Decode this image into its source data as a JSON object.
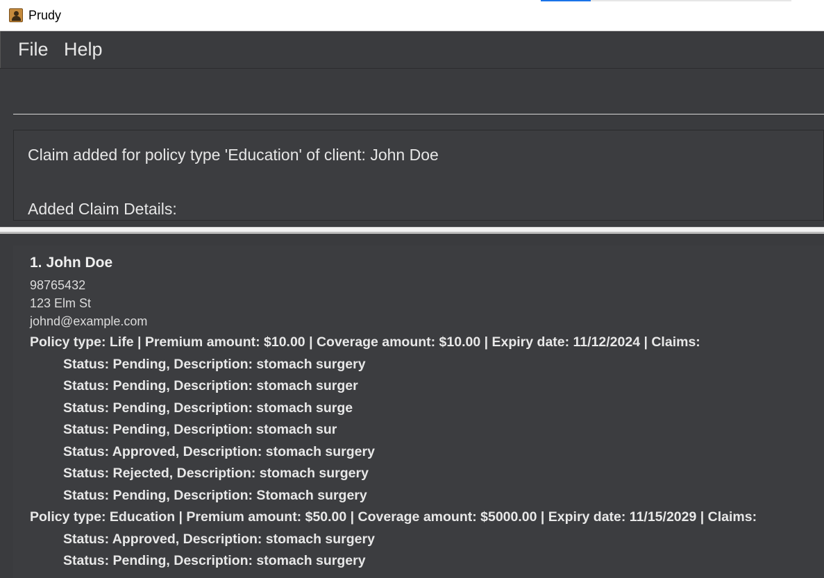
{
  "window": {
    "title": "Prudy"
  },
  "menu": {
    "items": [
      "File",
      "Help"
    ]
  },
  "command_box": {
    "value": "",
    "placeholder": ""
  },
  "result": {
    "lines": [
      "Claim added for policy type 'Education' of client: John Doe",
      "Added Claim Details:"
    ]
  },
  "persons": [
    {
      "index": "1.",
      "name": "John Doe",
      "phone": "98765432",
      "address": "123 Elm St",
      "email": "johnd@example.com",
      "policies": [
        {
          "header": "Policy type: Life | Premium amount: $10.00 | Coverage amount: $10.00 | Expiry date: 11/12/2024 | Claims:",
          "claims": [
            "Status: Pending, Description: stomach surgery",
            "Status: Pending, Description: stomach surger",
            "Status: Pending, Description: stomach surge",
            "Status: Pending, Description: stomach sur",
            "Status: Approved, Description: stomach surgery",
            "Status: Rejected, Description: stomach surgery",
            "Status: Pending, Description: Stomach surgery"
          ]
        },
        {
          "header": "Policy type: Education | Premium amount: $50.00 | Coverage amount: $5000.00 | Expiry date: 11/15/2029 | Claims:",
          "claims": [
            "Status: Approved, Description: stomach surgery",
            "Status: Pending, Description: stomach surgery"
          ]
        }
      ]
    }
  ],
  "colors": {
    "background_dark": "#3a3b3e",
    "card": "#3c3d40",
    "text": "#e8e8e8",
    "title_accent": "#1a73e8"
  }
}
